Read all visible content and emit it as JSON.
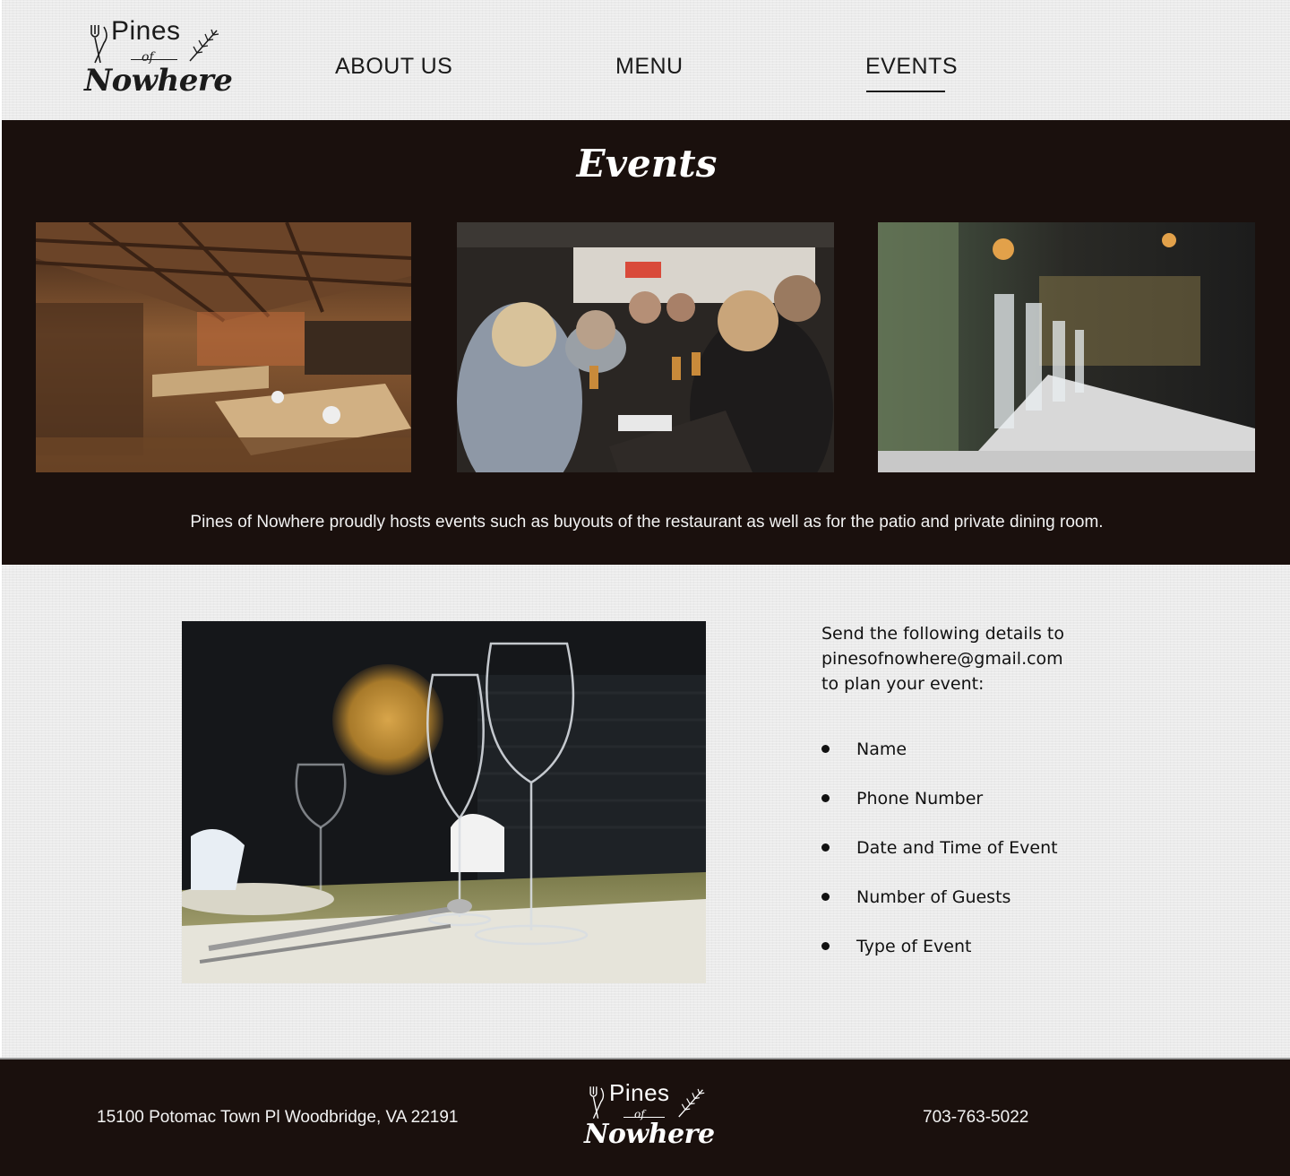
{
  "brand": {
    "logo_pines": "Pines",
    "logo_of": "of",
    "logo_nowhere": "Nowhere"
  },
  "nav": {
    "items": [
      {
        "label": "ABOUT US",
        "active": false
      },
      {
        "label": "MENU",
        "active": false
      },
      {
        "label": "EVENTS",
        "active": true
      }
    ]
  },
  "events": {
    "title": "Events",
    "photos": [
      "restaurant-interior-photo",
      "patio-dinner-guests-photo",
      "table-setting-blurred-photo"
    ],
    "description": "Pines of Nowhere proudly hosts events such as buyouts of the restaurant as well as for the patio and private dining room."
  },
  "planning": {
    "photo": "wine-glasses-photo",
    "intro_lines": [
      "Send the following details to",
      "pinesofnowhere@gmail.com",
      "to plan your event:"
    ],
    "details": [
      "Name",
      "Phone Number",
      "Date and Time of Event",
      "Number of Guests",
      "Type of Event"
    ]
  },
  "footer": {
    "address": "15100 Potomac Town Pl Woodbridge, VA 22191",
    "phone": "703-763-5022"
  },
  "colors": {
    "dark_band": "#1a100d",
    "linen": "#ebebeb",
    "text_dark": "#1a1a1a",
    "text_light": "#ffffff"
  }
}
